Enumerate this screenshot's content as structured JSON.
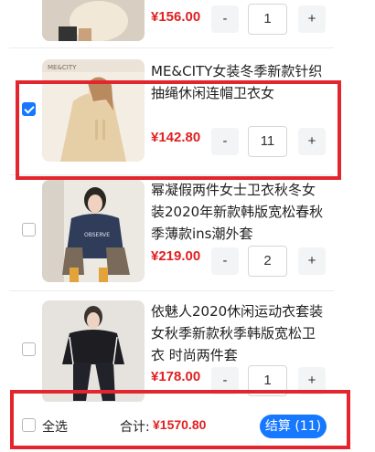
{
  "cart": {
    "items": [
      {
        "title": "",
        "price": "¥156.00",
        "quantity": "1",
        "checked": false
      },
      {
        "title": "ME&CITY女装冬季新款针织抽绳休闲连帽卫衣女",
        "price": "¥142.80",
        "quantity": "11",
        "checked": true
      },
      {
        "title": "幂凝假两件女士卫衣秋冬女装2020年新款韩版宽松春秋季薄款ins潮外套",
        "price": "¥219.00",
        "quantity": "2",
        "checked": false
      },
      {
        "title": "依魅人2020休闲运动衣套装女秋季新款秋季韩版宽松卫衣 时尚两件套",
        "price": "¥178.00",
        "quantity": "1",
        "checked": false
      }
    ],
    "stepper": {
      "minus": "-",
      "plus": "+"
    }
  },
  "footer": {
    "select_all_label": "全选",
    "total_label": "合计:",
    "total_value": "¥1570.80",
    "checkout_label": "结算 (11)"
  },
  "colors": {
    "accent": "#1677ff",
    "price": "#e02020",
    "highlight": "#e3262d"
  }
}
